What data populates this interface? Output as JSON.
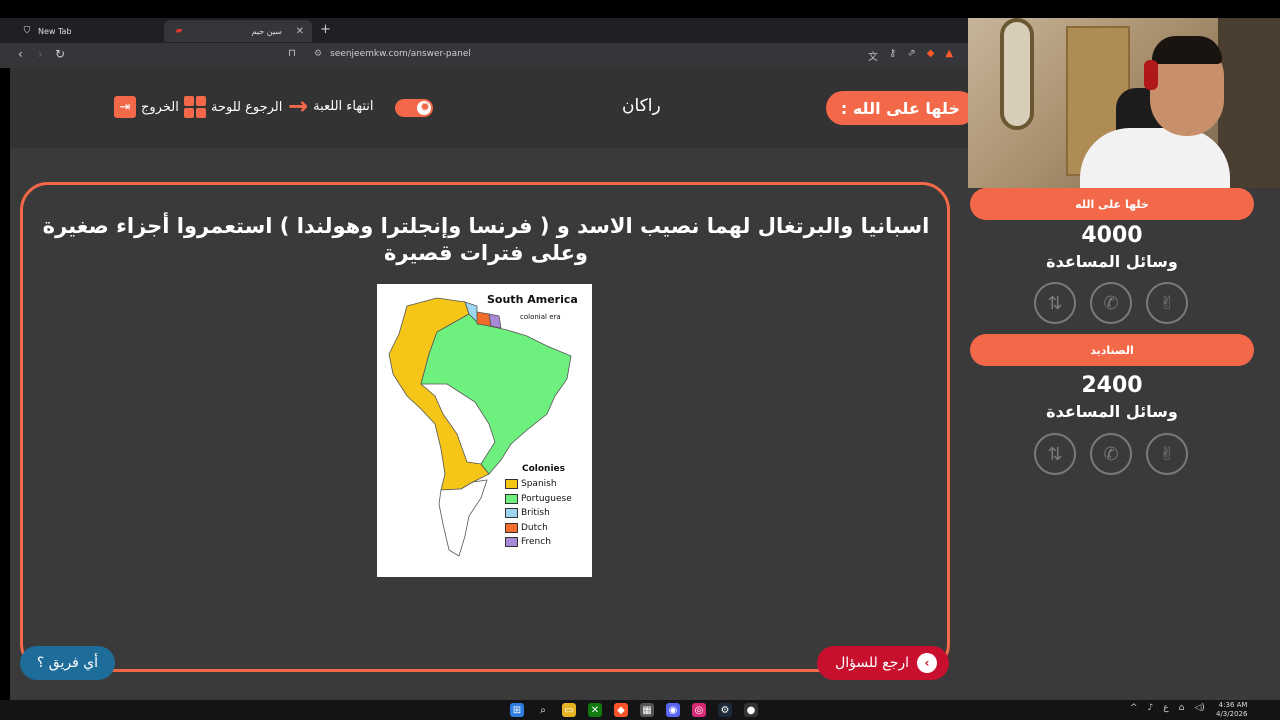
{
  "browser": {
    "tabs": [
      {
        "title": "New Tab",
        "active": false
      },
      {
        "title": "سين جيم",
        "active": true
      }
    ],
    "url": "seenjeemkw.com/answer-panel"
  },
  "header": {
    "exit_label": "الخروج",
    "back_to_board_label": "الرجوع للوحة",
    "end_game_label": "انتهاء اللعبة",
    "current_team": "راكان",
    "turn_label": ": خلها على الله"
  },
  "question": {
    "text": "اسبانيا والبرتغال لهما نصيب الاسد و ( فرنسا وإنجلترا وهولندا ) استعمروا أجزاء صغيرة وعلى فترات قصيرة"
  },
  "map": {
    "title": "South America",
    "subtitle": "colonial era",
    "legend_title": "Colonies",
    "legend": [
      {
        "label": "Spanish",
        "color": "#f5c518"
      },
      {
        "label": "Portuguese",
        "color": "#6ef07e"
      },
      {
        "label": "British",
        "color": "#9fd6ef"
      },
      {
        "label": "Dutch",
        "color": "#f26d2a"
      },
      {
        "label": "French",
        "color": "#a98ad6"
      }
    ]
  },
  "footer": {
    "back_to_question_label": "ارجع للسؤال",
    "which_team_label": "أي فريق ؟"
  },
  "teams": [
    {
      "name": "خلها على الله",
      "score": "4000",
      "helps_label": "وسائل المساعدة"
    },
    {
      "name": "الصناديد",
      "score": "2400",
      "helps_label": "وسائل المساعدة"
    }
  ],
  "clock": {
    "time": "4:36 AM",
    "date": "4/3/2026"
  },
  "colors": {
    "accent": "#f26849",
    "back_button": "#c8102e",
    "which_team": "#1e6c9a"
  }
}
